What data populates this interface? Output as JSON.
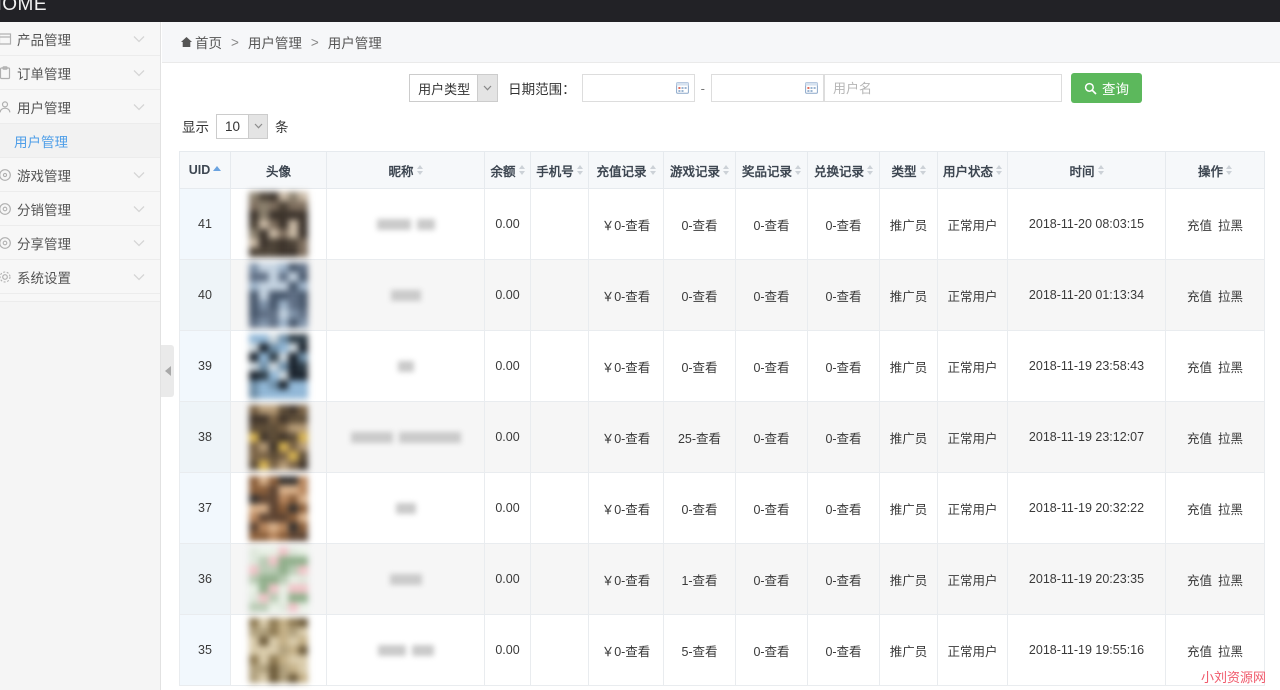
{
  "topbar": {
    "logo_text": "HOME"
  },
  "sidebar": {
    "items": [
      {
        "label": "产品管理",
        "icon": "box-icon",
        "expandable": true
      },
      {
        "label": "订单管理",
        "icon": "clipboard-icon",
        "expandable": true
      },
      {
        "label": "用户管理",
        "icon": "users-icon",
        "expandable": true
      }
    ],
    "active_sub": {
      "label": "用户管理"
    },
    "items_after": [
      {
        "label": "游戏管理",
        "icon": "gamepad-icon",
        "expandable": true
      },
      {
        "label": "分销管理",
        "icon": "share-node-icon",
        "expandable": true
      },
      {
        "label": "分享管理",
        "icon": "share-icon",
        "expandable": true
      },
      {
        "label": "系统设置",
        "icon": "gear-icon",
        "expandable": true
      }
    ]
  },
  "breadcrumb": {
    "home": "首页",
    "separator": ">",
    "items": [
      "用户管理",
      "用户管理"
    ]
  },
  "filters": {
    "user_type_value": "用户类型",
    "date_range_label": "日期范围：",
    "date_start_value": "",
    "date_end_value": "",
    "date_separator": "-",
    "username_placeholder": "用户名",
    "username_value": "",
    "search_button": "查询"
  },
  "length_menu": {
    "prefix": "显示",
    "value": "10",
    "suffix": "条"
  },
  "table": {
    "columns": [
      {
        "label": "UID",
        "sort": "asc"
      },
      {
        "label": "头像",
        "sort": "none"
      },
      {
        "label": "昵称",
        "sort": "both"
      },
      {
        "label": "余额",
        "sort": "both"
      },
      {
        "label": "手机号",
        "sort": "both"
      },
      {
        "label": "充值记录",
        "sort": "both"
      },
      {
        "label": "游戏记录",
        "sort": "both"
      },
      {
        "label": "奖品记录",
        "sort": "both"
      },
      {
        "label": "兑换记录",
        "sort": "both"
      },
      {
        "label": "类型",
        "sort": "both"
      },
      {
        "label": "用户状态",
        "sort": "both"
      },
      {
        "label": "时间",
        "sort": "both"
      },
      {
        "label": "操作",
        "sort": "both"
      }
    ],
    "rows": [
      {
        "uid": "41",
        "avatar": "blurred-avatar",
        "nickname": "",
        "balance": "0.00",
        "phone": "",
        "recharge": "￥0-查看",
        "game": "0-查看",
        "prize": "0-查看",
        "exchange": "0-查看",
        "type": "推广员",
        "status": "正常用户",
        "time": "2018-11-20 08:03:15",
        "op_recharge": "充值",
        "op_block": "拉黑"
      },
      {
        "uid": "40",
        "avatar": "blurred-avatar",
        "nickname": "",
        "balance": "0.00",
        "phone": "",
        "recharge": "￥0-查看",
        "game": "0-查看",
        "prize": "0-查看",
        "exchange": "0-查看",
        "type": "推广员",
        "status": "正常用户",
        "time": "2018-11-20 01:13:34",
        "op_recharge": "充值",
        "op_block": "拉黑"
      },
      {
        "uid": "39",
        "avatar": "blurred-avatar",
        "nickname": "",
        "balance": "0.00",
        "phone": "",
        "recharge": "￥0-查看",
        "game": "0-查看",
        "prize": "0-查看",
        "exchange": "0-查看",
        "type": "推广员",
        "status": "正常用户",
        "time": "2018-11-19 23:58:43",
        "op_recharge": "充值",
        "op_block": "拉黑"
      },
      {
        "uid": "38",
        "avatar": "blurred-avatar",
        "nickname": "",
        "balance": "0.00",
        "phone": "",
        "recharge": "￥0-查看",
        "game": "25-查看",
        "prize": "0-查看",
        "exchange": "0-查看",
        "type": "推广员",
        "status": "正常用户",
        "time": "2018-11-19 23:12:07",
        "op_recharge": "充值",
        "op_block": "拉黑"
      },
      {
        "uid": "37",
        "avatar": "blurred-avatar",
        "nickname": "",
        "balance": "0.00",
        "phone": "",
        "recharge": "￥0-查看",
        "game": "0-查看",
        "prize": "0-查看",
        "exchange": "0-查看",
        "type": "推广员",
        "status": "正常用户",
        "time": "2018-11-19 20:32:22",
        "op_recharge": "充值",
        "op_block": "拉黑"
      },
      {
        "uid": "36",
        "avatar": "blurred-avatar",
        "nickname": "",
        "balance": "0.00",
        "phone": "",
        "recharge": "￥0-查看",
        "game": "1-查看",
        "prize": "0-查看",
        "exchange": "0-查看",
        "type": "推广员",
        "status": "正常用户",
        "time": "2018-11-19 20:23:35",
        "op_recharge": "充值",
        "op_block": "拉黑"
      },
      {
        "uid": "35",
        "avatar": "blurred-avatar",
        "nickname": "",
        "balance": "0.00",
        "phone": "",
        "recharge": "￥0-查看",
        "game": "5-查看",
        "prize": "0-查看",
        "exchange": "0-查看",
        "type": "推广员",
        "status": "正常用户",
        "time": "2018-11-19 19:55:16",
        "op_recharge": "充值",
        "op_block": "拉黑"
      }
    ]
  },
  "watermark": {
    "text": "小刘资源网"
  },
  "colors": {
    "topbar": "#222226",
    "sidebar_bg": "#f7f7f7",
    "active_link": "#4e9ee8",
    "search_button": "#5cb85c",
    "table_header_bg": "#f6f8fa",
    "uid_cell_bg": "#f2f8fd",
    "watermark": "#f0596b"
  }
}
